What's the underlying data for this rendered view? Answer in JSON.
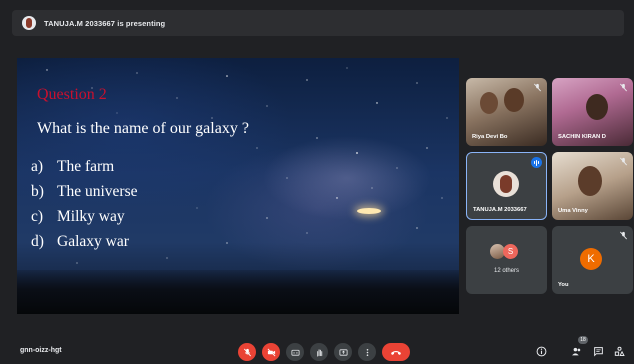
{
  "presenting_bar": {
    "text": "TANUJA.M 2033667 is presenting"
  },
  "slide": {
    "question_label": "Question 2",
    "question": "What is the name of our galaxy ?",
    "options": [
      {
        "letter": "a)",
        "text": "The farm"
      },
      {
        "letter": "b)",
        "text": "The universe"
      },
      {
        "letter": "c)",
        "text": "Milky way"
      },
      {
        "letter": "d)",
        "text": "Galaxy war"
      }
    ]
  },
  "participants": [
    {
      "name": "Riya Devi Bo",
      "muted": true
    },
    {
      "name": "SACHIN KIRAN D",
      "muted": true
    },
    {
      "name": "TANUJA.M 2033667",
      "speaking": true
    },
    {
      "name": "Uma Vinny",
      "muted": true
    },
    {
      "name": "12 others",
      "avatar_letter": "S"
    },
    {
      "name": "You",
      "avatar_letter": "K",
      "muted": true
    }
  ],
  "bottom_bar": {
    "meeting_code": "gnn-oizz-hgt",
    "people_count": "18"
  },
  "colors": {
    "background": "#202124",
    "tile": "#3c4043",
    "danger": "#ea4335",
    "accent_blue": "#1a73e8",
    "you_avatar": "#ef6c00",
    "question_label": "#c8102e"
  },
  "icons": {
    "mic": "mic-off-icon",
    "camera": "camera-off-icon",
    "captions": "captions-icon",
    "hand": "raise-hand-icon",
    "present": "present-screen-icon",
    "more": "more-options-icon",
    "end": "end-call-icon",
    "info": "info-icon",
    "people": "people-icon",
    "chat": "chat-icon",
    "activities": "activities-icon"
  }
}
